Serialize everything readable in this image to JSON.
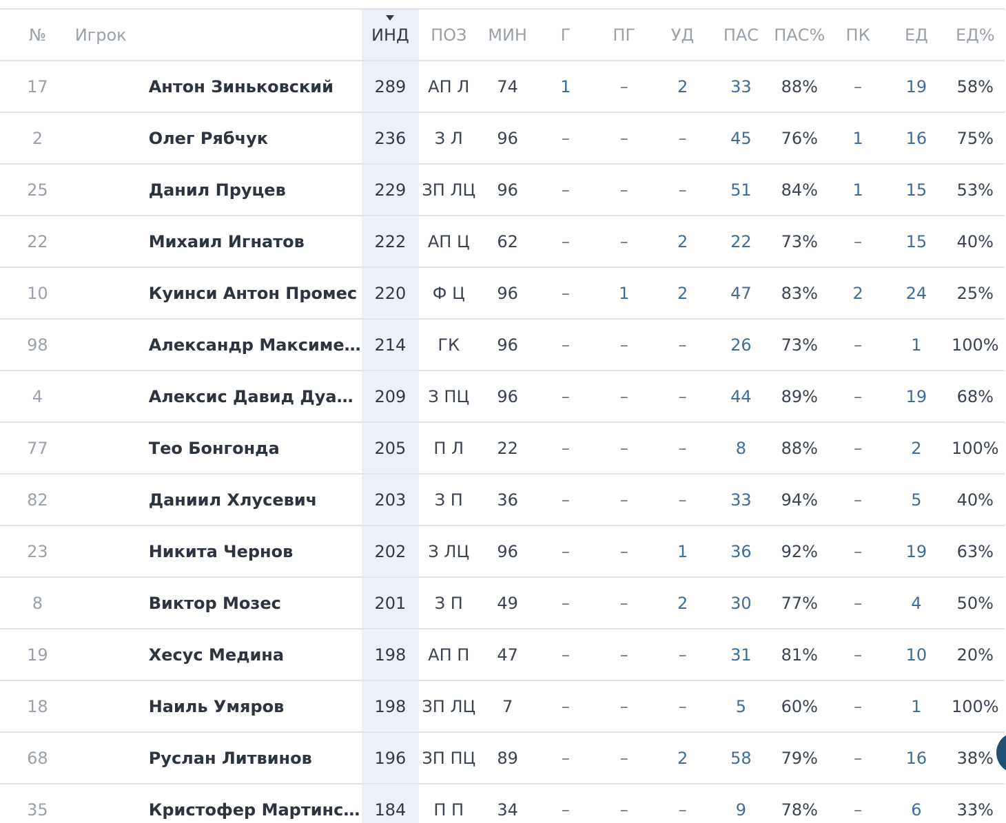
{
  "columns": {
    "num": "№",
    "player": "Игрок",
    "ind": "ИНД",
    "pos": "ПОЗ",
    "min": "МИН",
    "g": "Г",
    "pg": "ПГ",
    "ud": "УД",
    "pas": "ПАС",
    "pas_pct": "ПАС%",
    "pk": "ПК",
    "ed": "ЕД",
    "ed_pct": "ЕД%"
  },
  "sort": {
    "column": "ind",
    "direction": "desc",
    "icon": "sort-down-icon"
  },
  "colors": {
    "accent_link": "#3f6d9a",
    "sorted_column_bg": "#eaf1f8",
    "side_button": "#1f4e73"
  },
  "rows": [
    {
      "num": "17",
      "player": "Антон Зиньковский",
      "ind": "289",
      "pos": "АП Л",
      "min": "74",
      "g": "1",
      "pg": "–",
      "ud": "2",
      "pas": "33",
      "pas_pct": "88%",
      "pk": "–",
      "ed": "19",
      "ed_pct": "58%"
    },
    {
      "num": "2",
      "player": "Олег Рябчук",
      "ind": "236",
      "pos": "З Л",
      "min": "96",
      "g": "–",
      "pg": "–",
      "ud": "–",
      "pas": "45",
      "pas_pct": "76%",
      "pk": "1",
      "ed": "16",
      "ed_pct": "75%"
    },
    {
      "num": "25",
      "player": "Данил Пруцев",
      "ind": "229",
      "pos": "ЗП ЛЦ",
      "min": "96",
      "g": "–",
      "pg": "–",
      "ud": "–",
      "pas": "51",
      "pas_pct": "84%",
      "pk": "1",
      "ed": "15",
      "ed_pct": "53%"
    },
    {
      "num": "22",
      "player": "Михаил Игнатов",
      "ind": "222",
      "pos": "АП Ц",
      "min": "62",
      "g": "–",
      "pg": "–",
      "ud": "2",
      "pas": "22",
      "pas_pct": "73%",
      "pk": "–",
      "ed": "15",
      "ed_pct": "40%"
    },
    {
      "num": "10",
      "player": "Куинси Антон Промес",
      "ind": "220",
      "pos": "Ф Ц",
      "min": "96",
      "g": "–",
      "pg": "1",
      "ud": "2",
      "pas": "47",
      "pas_pct": "83%",
      "pk": "2",
      "ed": "24",
      "ed_pct": "25%"
    },
    {
      "num": "98",
      "player": "Александр Максименко",
      "ind": "214",
      "pos": "ГК",
      "min": "96",
      "g": "–",
      "pg": "–",
      "ud": "–",
      "pas": "26",
      "pas_pct": "73%",
      "pk": "–",
      "ed": "1",
      "ed_pct": "100%"
    },
    {
      "num": "4",
      "player": "Алексис Давид Дуарте Пере...",
      "ind": "209",
      "pos": "З ПЦ",
      "min": "96",
      "g": "–",
      "pg": "–",
      "ud": "–",
      "pas": "44",
      "pas_pct": "89%",
      "pk": "–",
      "ed": "19",
      "ed_pct": "68%"
    },
    {
      "num": "77",
      "player": "Тео Бонгонда",
      "ind": "205",
      "pos": "П Л",
      "min": "22",
      "g": "–",
      "pg": "–",
      "ud": "–",
      "pas": "8",
      "pas_pct": "88%",
      "pk": "–",
      "ed": "2",
      "ed_pct": "100%"
    },
    {
      "num": "82",
      "player": "Даниил Хлусевич",
      "ind": "203",
      "pos": "З П",
      "min": "36",
      "g": "–",
      "pg": "–",
      "ud": "–",
      "pas": "33",
      "pas_pct": "94%",
      "pk": "–",
      "ed": "5",
      "ed_pct": "40%"
    },
    {
      "num": "23",
      "player": "Никита Чернов",
      "ind": "202",
      "pos": "З ЛЦ",
      "min": "96",
      "g": "–",
      "pg": "–",
      "ud": "1",
      "pas": "36",
      "pas_pct": "92%",
      "pk": "–",
      "ed": "19",
      "ed_pct": "63%"
    },
    {
      "num": "8",
      "player": "Виктор Мозес",
      "ind": "201",
      "pos": "З П",
      "min": "49",
      "g": "–",
      "pg": "–",
      "ud": "2",
      "pas": "30",
      "pas_pct": "77%",
      "pk": "–",
      "ed": "4",
      "ed_pct": "50%"
    },
    {
      "num": "19",
      "player": "Хесус Медина",
      "ind": "198",
      "pos": "АП П",
      "min": "47",
      "g": "–",
      "pg": "–",
      "ud": "–",
      "pas": "31",
      "pas_pct": "81%",
      "pk": "–",
      "ed": "10",
      "ed_pct": "20%"
    },
    {
      "num": "18",
      "player": "Наиль Умяров",
      "ind": "198",
      "pos": "ЗП ЛЦ",
      "min": "7",
      "g": "–",
      "pg": "–",
      "ud": "–",
      "pas": "5",
      "pas_pct": "60%",
      "pk": "–",
      "ed": "1",
      "ed_pct": "100%"
    },
    {
      "num": "68",
      "player": "Руслан Литвинов",
      "ind": "196",
      "pos": "ЗП ПЦ",
      "min": "89",
      "g": "–",
      "pg": "–",
      "ud": "2",
      "pas": "58",
      "pas_pct": "79%",
      "pk": "–",
      "ed": "16",
      "ed_pct": "38%"
    },
    {
      "num": "35",
      "player": "Кристофер Мартинс Перейра",
      "ind": "184",
      "pos": "П П",
      "min": "34",
      "g": "–",
      "pg": "–",
      "ud": "–",
      "pas": "9",
      "pas_pct": "78%",
      "pk": "–",
      "ed": "6",
      "ed_pct": "33%"
    }
  ]
}
